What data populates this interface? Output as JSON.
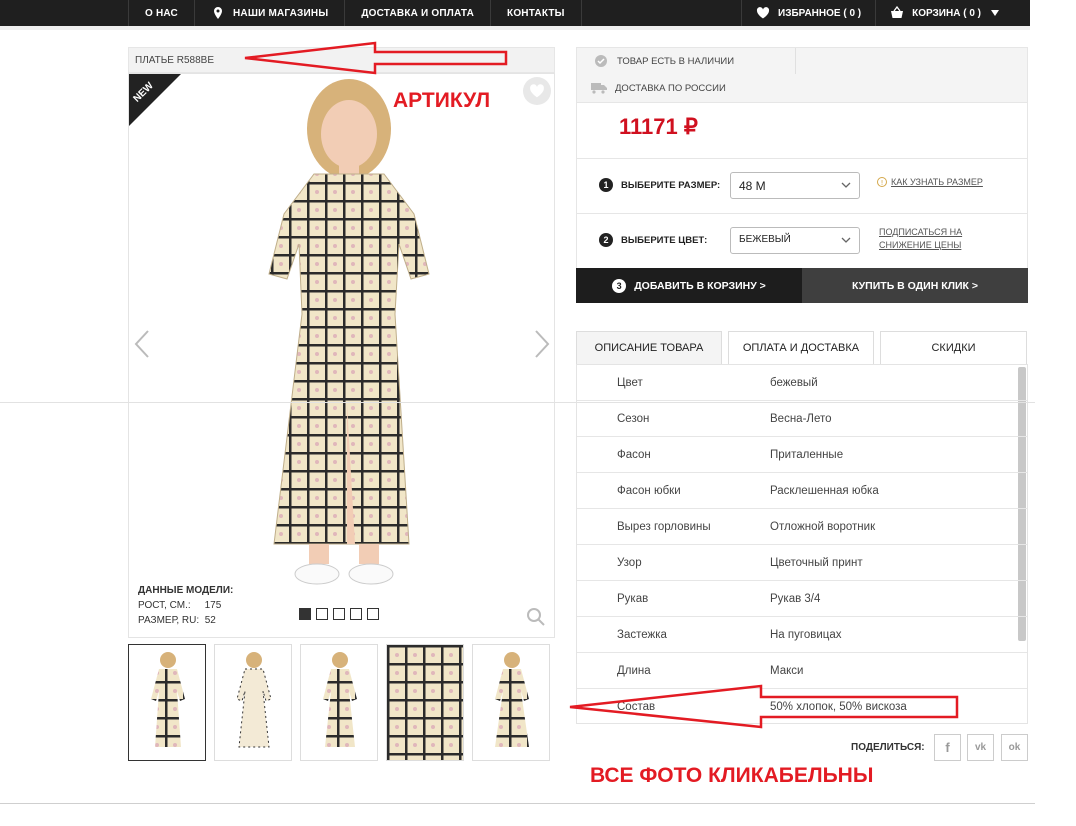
{
  "nav": {
    "left": [
      "О НАС",
      "НАШИ МАГАЗИНЫ",
      "ДОСТАВКА И ОПЛАТА",
      "КОНТАКТЫ"
    ],
    "favorites": "ИЗБРАННОЕ ( 0 )",
    "cart": "КОРЗИНА ( 0 )"
  },
  "product": {
    "article": "ПЛАТЬЕ R588BE",
    "badge": "NEW",
    "model_title": "ДАННЫЕ МОДЕЛИ:",
    "model_height_label": "РОСТ, СМ.:",
    "model_height": "175",
    "model_size_label": "РАЗМЕР, RU:",
    "model_size": "52",
    "slides_total": 5,
    "slide_active": 1,
    "thumbs_count": 5
  },
  "availability": {
    "in_stock": "ТОВАР ЕСТЬ В НАЛИЧИИ",
    "delivery": "ДОСТАВКА ПО РОССИИ"
  },
  "price": "11171 ₽",
  "size": {
    "step": "1",
    "label": "ВЫБЕРИТЕ РАЗМЕР:",
    "value": "48 M",
    "help": "КАК УЗНАТЬ РАЗМЕР"
  },
  "color": {
    "step": "2",
    "label": "ВЫБЕРИТЕ ЦВЕТ:",
    "value": "БЕЖЕВЫЙ",
    "subscribe_line1": "ПОДПИСАТЬСЯ НА",
    "subscribe_line2": "СНИЖЕНИЕ ЦЕНЫ"
  },
  "buttons": {
    "add_step": "3",
    "add": "ДОБАВИТЬ В КОРЗИНУ >",
    "buy": "КУПИТЬ В ОДИН КЛИК >"
  },
  "tabs": [
    "ОПИСАНИЕ ТОВАРА",
    "ОПЛАТА И ДОСТАВКА",
    "СКИДКИ"
  ],
  "specs": [
    {
      "k": "Цвет",
      "v": "бежевый"
    },
    {
      "k": "Сезон",
      "v": "Весна-Лето"
    },
    {
      "k": "Фасон",
      "v": "Приталенные"
    },
    {
      "k": "Фасон юбки",
      "v": "Расклешенная юбка"
    },
    {
      "k": "Вырез горловины",
      "v": "Отложной воротник"
    },
    {
      "k": "Узор",
      "v": "Цветочный принт"
    },
    {
      "k": "Рукав",
      "v": "Рукав 3/4"
    },
    {
      "k": "Застежка",
      "v": "На пуговицах"
    },
    {
      "k": "Длина",
      "v": "Макси"
    },
    {
      "k": "Состав",
      "v": "50% хлопок, 50% вискоза"
    }
  ],
  "share": {
    "label": "ПОДЕЛИТЬСЯ:",
    "networks": [
      "f",
      "vk",
      "ok"
    ]
  },
  "annotations": {
    "article": "АРТИКУЛ",
    "photos": "ВСЕ ФОТО КЛИКАБЕЛЬНЫ"
  },
  "colors": {
    "accent": "#e31b23",
    "price": "#d0101f",
    "nav": "#1f1f1f"
  }
}
